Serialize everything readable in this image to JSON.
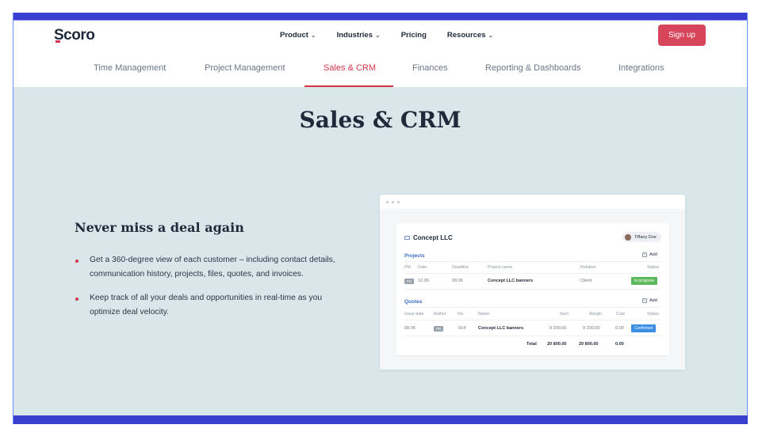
{
  "header": {
    "logo": "Scoro",
    "nav": [
      {
        "label": "Product",
        "has_dropdown": true
      },
      {
        "label": "Industries",
        "has_dropdown": true
      },
      {
        "label": "Pricing",
        "has_dropdown": false
      },
      {
        "label": "Resources",
        "has_dropdown": true
      }
    ],
    "chevron": "⌄",
    "signup_label": "Sign up"
  },
  "tabs": [
    {
      "label": "Time Management",
      "active": false
    },
    {
      "label": "Project Management",
      "active": false
    },
    {
      "label": "Sales & CRM",
      "active": true
    },
    {
      "label": "Finances",
      "active": false
    },
    {
      "label": "Reporting & Dashboards",
      "active": false
    },
    {
      "label": "Integrations",
      "active": false
    }
  ],
  "hero": {
    "title": "Sales & CRM",
    "feature_title": "Never miss a deal again",
    "bullets": [
      "Get a 360-degree view of each customer – including contact details, communication history, projects, files, quotes, and invoices.",
      "Keep track of all your deals and opportunities in real-time as you optimize deal velocity."
    ]
  },
  "mockup": {
    "company": "Concept LLC",
    "user": "Tiffany Doe",
    "add_label": "Add",
    "projects": {
      "title": "Projects",
      "headers": [
        "PM",
        "Date",
        "Deadline",
        "Project name",
        "Relation",
        "Status"
      ],
      "row": {
        "pm": "PS",
        "date": "12.06",
        "deadline": "28.06",
        "name": "Concept LLC banners",
        "relation": "Client",
        "status": "In progress"
      }
    },
    "quotes": {
      "title": "Quotes",
      "headers": [
        "Issue date",
        "Author",
        "No.",
        "Name",
        "Sum",
        "Margin",
        "Cost",
        "Status"
      ],
      "row": {
        "date": "08.06",
        "author": "PS",
        "no": "014",
        "name": "Concept LLC banners",
        "sum": "9 200.00",
        "margin": "9 200.00",
        "cost": "0.00",
        "status": "Confirmed"
      },
      "total_label": "Total",
      "total_sum": "20 800.00",
      "total_margin": "20 800.00",
      "total_cost": "0.00"
    }
  },
  "colors": {
    "accent": "#d6334c",
    "hero_bg": "#d9e6ea",
    "frame": "#3a3fcf",
    "link_blue": "#3b6cc2",
    "status_green": "#5cb85c",
    "status_blue": "#3a8ee6"
  }
}
